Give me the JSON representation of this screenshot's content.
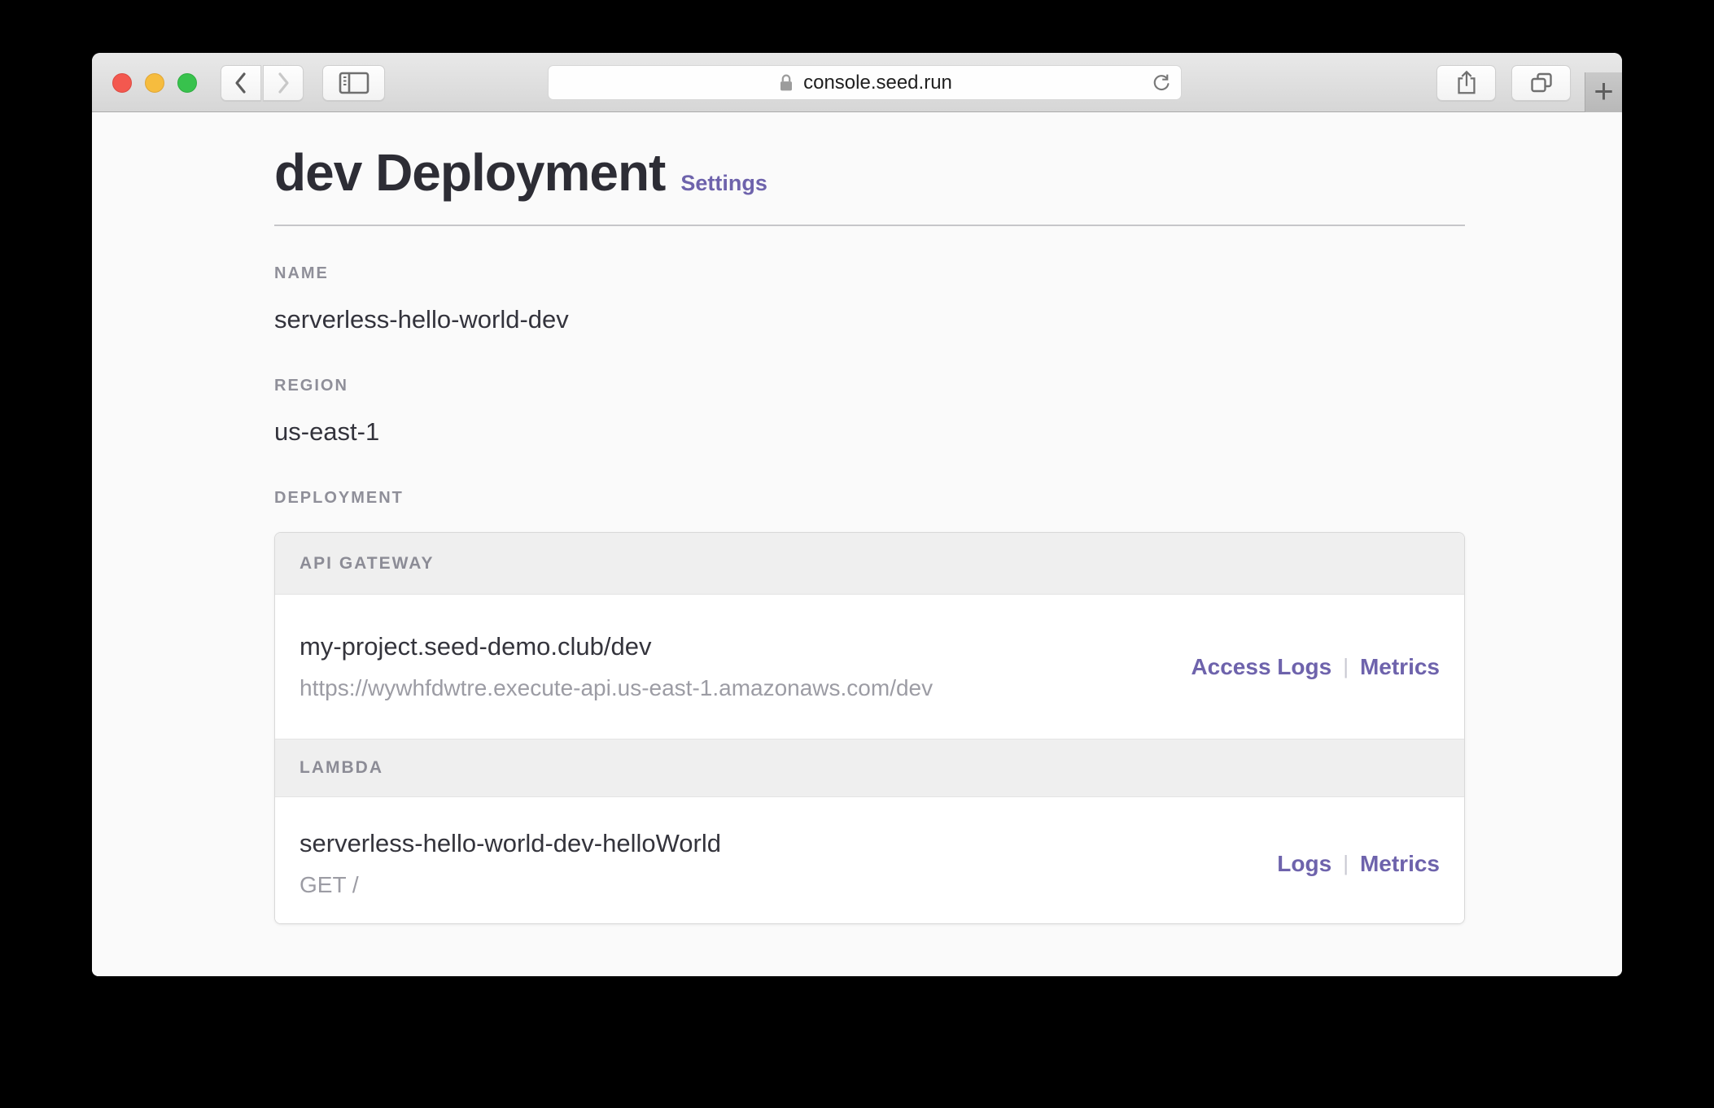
{
  "browser": {
    "url": "console.seed.run",
    "new_tab_glyph": "+"
  },
  "page": {
    "title": "dev Deployment",
    "settings_label": "Settings",
    "fields": [
      {
        "label": "NAME",
        "value": "serverless-hello-world-dev"
      },
      {
        "label": "REGION",
        "value": "us-east-1"
      }
    ],
    "deployment_label": "DEPLOYMENT",
    "link_separator": "|",
    "panel": {
      "sections": [
        {
          "header": "API GATEWAY",
          "rows": [
            {
              "title": "my-project.seed-demo.club/dev",
              "subtitle": "https://wywhfdwtre.execute-api.us-east-1.amazonaws.com/dev",
              "links": [
                "Access Logs",
                "Metrics"
              ]
            }
          ]
        },
        {
          "header": "LAMBDA",
          "rows": [
            {
              "title": "serverless-hello-world-dev-helloWorld",
              "subtitle": "GET /",
              "links": [
                "Logs",
                "Metrics"
              ]
            }
          ]
        }
      ]
    }
  },
  "colors": {
    "accent_purple": "#6e63ac",
    "traffic_red": "#f3584f",
    "traffic_yellow": "#f6bc3e",
    "traffic_green": "#38c24d",
    "page_background": "#fafafa",
    "panel_header_background": "#efefef"
  }
}
